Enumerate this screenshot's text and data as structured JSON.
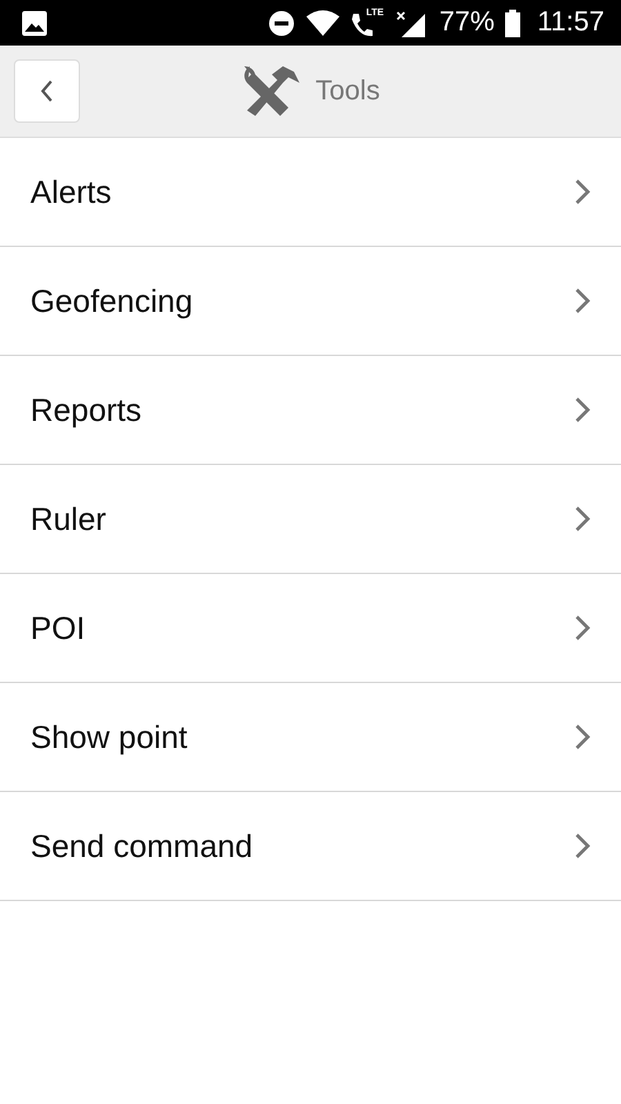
{
  "status_bar": {
    "call_label": "LTE",
    "battery": "77%",
    "time": "11:57"
  },
  "header": {
    "title": "Tools"
  },
  "menu": [
    {
      "label": "Alerts"
    },
    {
      "label": "Geofencing"
    },
    {
      "label": "Reports"
    },
    {
      "label": "Ruler"
    },
    {
      "label": "POI"
    },
    {
      "label": "Show point"
    },
    {
      "label": "Send command"
    }
  ]
}
